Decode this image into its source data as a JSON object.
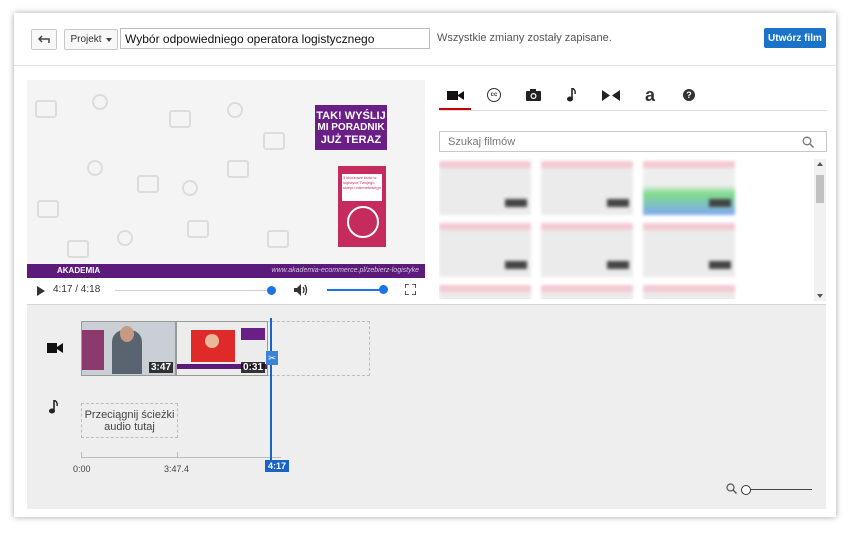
{
  "header": {
    "back_icon": "undo-arrow-icon",
    "project_label": "Projekt",
    "project_title": "Wybór odpowiedniego operatora logistycznego",
    "saved_status": "Wszystkie zmiany zostały zapisane.",
    "create_label": "Utwórz film"
  },
  "preview": {
    "promo_line1": "TAK! WYŚLIJ",
    "promo_line2": "MI PORADNIK",
    "promo_line3": "JUŻ TERAZ",
    "book_title": "3 kluczowe kroki w logistyce Twojego sklepu internetowego",
    "academy_label": "AKADEMIA",
    "academy_url": "www.akademia-ecommerce.pl/zebierz-logistyke"
  },
  "player": {
    "time": "4:17 / 4:18",
    "progress_fraction": 0.99,
    "volume_fraction": 1.0
  },
  "tabs": {
    "icons": [
      "video-camera-icon",
      "closed-captions-icon",
      "camera-icon",
      "music-note-icon",
      "transition-icon",
      "annotation-icon",
      "help-icon"
    ],
    "active_index": 0,
    "active_color": "#cc0000",
    "cc_glyph": "cc",
    "annotation_glyph": "a",
    "help_glyph": "?"
  },
  "search": {
    "placeholder": "Szukaj filmów"
  },
  "timeline": {
    "clip1_duration": "3:47",
    "clip2_duration": "0:31",
    "audio_drop_text": "Przeciągnij ścieżki audio tutaj",
    "ruler_start": "0:00",
    "ruler_mid": "3:47.4",
    "playhead_time": "4:17"
  },
  "colors": {
    "accent_blue": "#1a73c8",
    "promo_purple": "#6a1f87"
  }
}
